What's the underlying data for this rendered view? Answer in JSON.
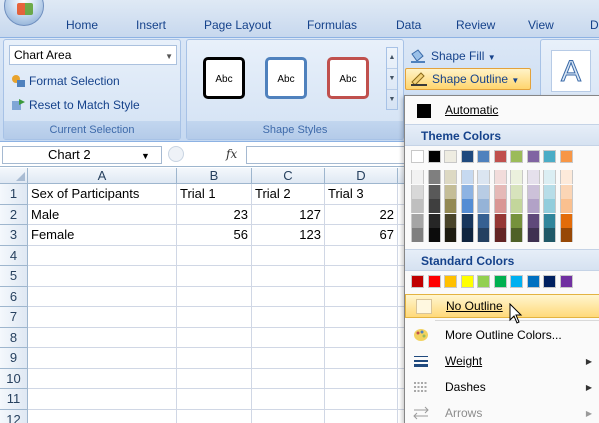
{
  "ribbon": {
    "tabs": [
      "Home",
      "Insert",
      "Page Layout",
      "Formulas",
      "Data",
      "Review",
      "View",
      "D"
    ],
    "current_selection": {
      "dropdown_value": "Chart Area",
      "format_selection": "Format Selection",
      "reset_to_match_style": "Reset to Match Style",
      "group_label": "Current Selection"
    },
    "shape_styles": {
      "swatch_label": "Abc",
      "swatch_colors": [
        "#000000",
        "#4f81bd",
        "#c0504d"
      ],
      "shape_fill": "Shape Fill",
      "shape_outline": "Shape Outline",
      "group_label": "Shape Styles"
    },
    "wordart_glyph": "A"
  },
  "formula_bar": {
    "name_box": "Chart 2",
    "fx_label": "fx",
    "formula": ""
  },
  "sheet": {
    "columns": [
      "A",
      "B",
      "C",
      "D"
    ],
    "row_numbers": [
      "1",
      "2",
      "3",
      "4",
      "5",
      "6",
      "7",
      "8",
      "9",
      "10",
      "11",
      "12"
    ],
    "rows": [
      [
        "Sex of Participants",
        "Trial 1",
        "Trial 2",
        "Trial 3"
      ],
      [
        "Male",
        "23",
        "127",
        "22"
      ],
      [
        "Female",
        "56",
        "123",
        "67"
      ]
    ]
  },
  "outline_menu": {
    "automatic": "Automatic",
    "theme_colors_heading": "Theme Colors",
    "theme_top_row": [
      "#ffffff",
      "#000000",
      "#eeece1",
      "#1f497d",
      "#4f81bd",
      "#c0504d",
      "#9bbb59",
      "#8064a2",
      "#4bacc6",
      "#f79646"
    ],
    "theme_shades": [
      [
        "#f2f2f2",
        "#7f7f7f",
        "#ddd9c3",
        "#c6d9f0",
        "#dbe5f1",
        "#f2dcdb",
        "#ebf1dd",
        "#e5e0ec",
        "#dbeef3",
        "#fdeada"
      ],
      [
        "#d8d8d8",
        "#595959",
        "#c4bd97",
        "#8db3e2",
        "#b8cce4",
        "#e5b9b7",
        "#d7e3bc",
        "#ccc1d9",
        "#b7dde8",
        "#fbd5b5"
      ],
      [
        "#bfbfbf",
        "#3f3f3f",
        "#938953",
        "#548dd4",
        "#95b3d7",
        "#d99694",
        "#c3d69b",
        "#b2a2c7",
        "#92cddc",
        "#fac08f"
      ],
      [
        "#a5a5a5",
        "#262626",
        "#494429",
        "#17365d",
        "#366092",
        "#953734",
        "#76923c",
        "#5f497a",
        "#31859b",
        "#e36c09"
      ],
      [
        "#7f7f7f",
        "#0c0c0c",
        "#1d1b10",
        "#0f243e",
        "#244061",
        "#632423",
        "#4f6128",
        "#3f3151",
        "#205867",
        "#974806"
      ]
    ],
    "standard_colors_heading": "Standard Colors",
    "standard_colors": [
      "#c00000",
      "#ff0000",
      "#ffc000",
      "#ffff00",
      "#92d050",
      "#00b050",
      "#00b0f0",
      "#0070c0",
      "#002060",
      "#7030a0"
    ],
    "no_outline": "No Outline",
    "more_outline_colors": "More Outline Colors...",
    "weight": "Weight",
    "dashes": "Dashes",
    "arrows": "Arrows"
  }
}
